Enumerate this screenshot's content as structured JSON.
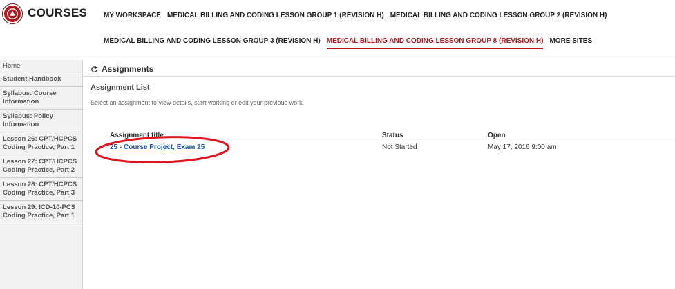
{
  "header": {
    "brand": "COURSES",
    "nav_row1": [
      "MY WORKSPACE",
      "MEDICAL BILLING AND CODING LESSON GROUP 1 (REVISION H)",
      "MEDICAL BILLING AND CODING LESSON GROUP 2 (REVISION H)"
    ],
    "nav_row2": [
      "MEDICAL BILLING AND CODING LESSON GROUP 3 (REVISION H)",
      "MEDICAL BILLING AND CODING LESSON GROUP 8 (REVISION H)",
      "MORE SITES"
    ],
    "active_site": "MEDICAL BILLING AND CODING LESSON GROUP 8 (REVISION H)",
    "accent_color": "#b3191e"
  },
  "sidebar": {
    "items": [
      "Home",
      "Student Handbook",
      "Syllabus: Course Information",
      "Syllabus: Policy Information",
      "Lesson 26: CPT/HCPCS Coding Practice, Part 1",
      "Lesson 27: CPT/HCPCS Coding Practice, Part 2",
      "Lesson 28: CPT/HCPCS Coding Practice, Part 3",
      "Lesson 29: ICD-10-PCS Coding Practice, Part 1"
    ]
  },
  "main": {
    "tool_title": "Assignments",
    "section_title": "Assignment List",
    "instruction": "Select an assignment to view details, start working or edit your previous work.",
    "columns": {
      "title": "Assignment title",
      "status": "Status",
      "open": "Open"
    },
    "rows": [
      {
        "title": "25 - Course Project, Exam 25",
        "status": "Not Started",
        "open": "May 17, 2016 9:00 am"
      }
    ],
    "highlight_color": "#e0141e"
  }
}
